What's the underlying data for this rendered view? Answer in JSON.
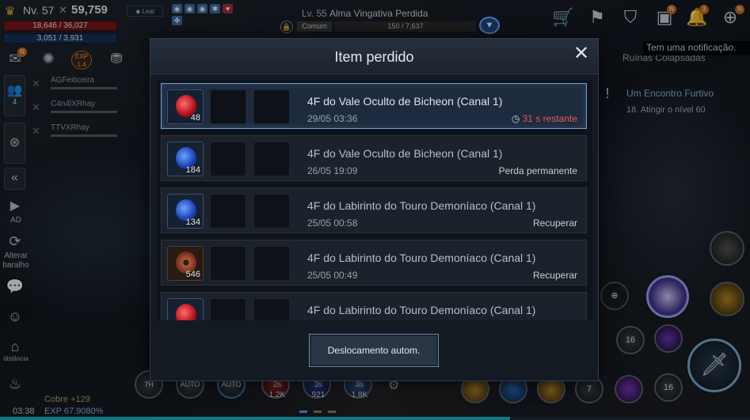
{
  "hud": {
    "level": "Nv. 57",
    "power": "59,759",
    "alignment": "Leal",
    "hp": "18,646 / 36,027",
    "hp_fraction": 0.517,
    "mp": "3,051 / 3,931",
    "mp_fraction": 0.776
  },
  "target": {
    "level": "Lv. 55",
    "name": "Alma Vingativa Perdida",
    "rarity": "Comum",
    "hp": "150 / 7,637"
  },
  "top_icons": [
    "shop-icon",
    "banner-icon",
    "costume-icon",
    "inventory-icon",
    "bell-icon",
    "plus-icon"
  ],
  "badges": {
    "inventory": "N",
    "bell": "3",
    "plus": "N"
  },
  "notification": "Tem uma notificação.",
  "zone_hint": "Ruínas Colapsadas",
  "quest": {
    "title": "Um Encontro Furtivo",
    "sub": "18. Atingir o nível 60"
  },
  "left": {
    "party_count": "4",
    "party_members": [
      "AGFeiticeira",
      "C4n4lXRhay",
      "TTVXRhay"
    ],
    "ad_label": "AD",
    "swap_label": "Alterar baralho",
    "distance_label": "distância",
    "exp_badge": "1.4"
  },
  "bottom": {
    "time": "03:38",
    "currency": "Cobre +129",
    "exp": "EXP 67.9080%",
    "auto_labels": [
      "7H",
      "AUTO",
      "AUTO"
    ],
    "cooldowns": [
      {
        "time": "2s",
        "count": "1.2K"
      },
      {
        "time": "3s",
        "count": "921"
      },
      {
        "time": "3s",
        "count": "1.8K"
      }
    ],
    "skill_numbers": [
      "7",
      "16",
      "16"
    ]
  },
  "modal": {
    "title": "Item perdido",
    "auto_button": "Deslocamento autom.",
    "rows": [
      {
        "location": "4F do Vale Oculto de Bicheon (Canal 1)",
        "date": "29/05 03:36",
        "status": "31 s restante",
        "qty": "48",
        "item": "red-potion"
      },
      {
        "location": "4F do Vale Oculto de Bicheon (Canal 1)",
        "date": "26/05 19:09",
        "status": "Perda permanente",
        "qty": "184",
        "item": "blue-potion"
      },
      {
        "location": "4F do Labirinto do Touro Demoníaco (Canal 1)",
        "date": "25/05 00:58",
        "status": "Recuperar",
        "qty": "134",
        "item": "blue-potion"
      },
      {
        "location": "4F do Labirinto do Touro Demoníaco (Canal 1)",
        "date": "25/05 00:49",
        "status": "Recuperar",
        "qty": "546",
        "item": "copper-coin"
      },
      {
        "location": "4F do Labirinto do Touro Demoníaco (Canal 1)",
        "date": "",
        "status": "",
        "qty": "",
        "item": "red-potion"
      }
    ]
  }
}
